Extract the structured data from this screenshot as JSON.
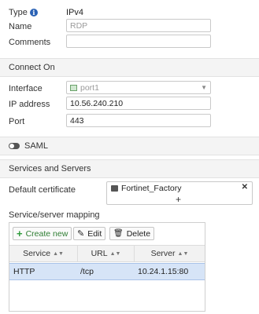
{
  "form": {
    "type_label": "Type",
    "type_value": "IPv4",
    "name_label": "Name",
    "name_value": "RDP",
    "comments_label": "Comments",
    "comments_value": ""
  },
  "connect_on": {
    "section_title": "Connect On",
    "interface_label": "Interface",
    "interface_value": "port1",
    "ip_label": "IP address",
    "ip_value": "10.56.240.210",
    "port_label": "Port",
    "port_value": "443"
  },
  "saml": {
    "label": "SAML",
    "enabled": false
  },
  "services": {
    "section_title": "Services and Servers",
    "default_cert_label": "Default certificate",
    "cert_name": "Fortinet_Factory",
    "add_symbol": "+",
    "remove_symbol": "✕",
    "mapping_label": "Service/server mapping",
    "create_new_label": "Create new",
    "edit_label": "Edit",
    "delete_label": "Delete",
    "columns": [
      "Service",
      "URL",
      "Server"
    ],
    "rows": [
      {
        "service": "HTTP",
        "url": "/tcp",
        "server": "10.24.1.15:80"
      }
    ]
  },
  "colors": {
    "accent": "#2a62b5",
    "selected_row": "#d6e4f7",
    "create_new_green": "#2e9b3a"
  }
}
